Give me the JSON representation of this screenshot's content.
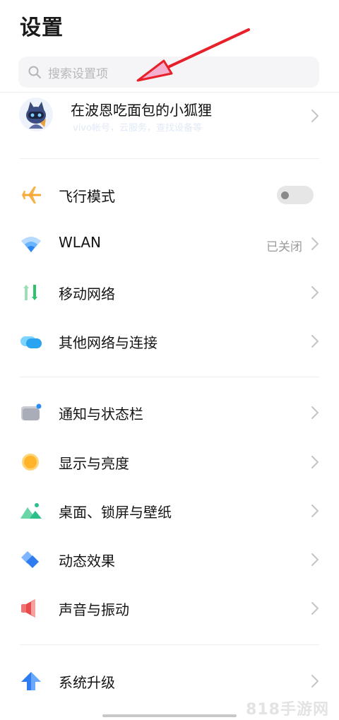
{
  "page": {
    "title": "设置"
  },
  "search": {
    "placeholder": "搜索设置项"
  },
  "account": {
    "name": "在波恩吃面包的小狐狸",
    "subtitle": "vivo帐号，云服务，查找设备等"
  },
  "settings": [
    {
      "label": "飞行模式",
      "icon": "airplane-icon",
      "control": "toggle",
      "on": false
    },
    {
      "label": "WLAN",
      "icon": "wifi-icon",
      "status": "已关闭"
    },
    {
      "label": "移动网络",
      "icon": "mobile-data-icon"
    },
    {
      "label": "其他网络与连接",
      "icon": "connections-icon"
    },
    {
      "label": "通知与状态栏",
      "icon": "notification-icon"
    },
    {
      "label": "显示与亮度",
      "icon": "brightness-icon"
    },
    {
      "label": "桌面、锁屏与壁纸",
      "icon": "wallpaper-icon"
    },
    {
      "label": "动态效果",
      "icon": "motion-effects-icon"
    },
    {
      "label": "声音与振动",
      "icon": "sound-icon"
    },
    {
      "label": "系统升级",
      "icon": "system-update-icon"
    }
  ],
  "watermark": "818手游网",
  "colors": {
    "arrow": "#e8202a",
    "chevron": "#c4c4c4"
  }
}
